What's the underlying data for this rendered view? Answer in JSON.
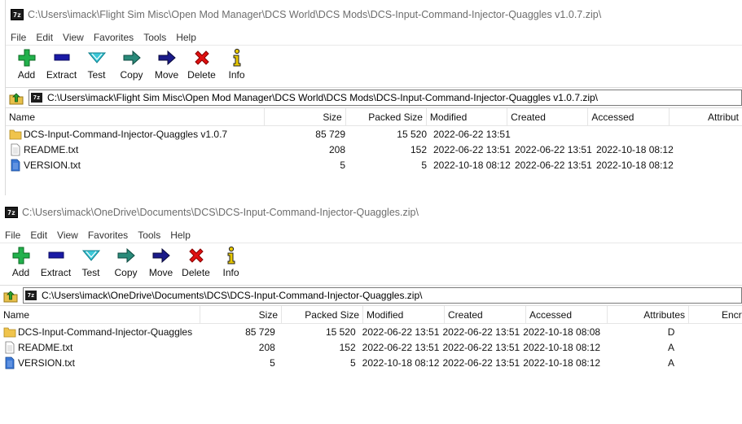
{
  "windows": [
    {
      "title": "C:\\Users\\imack\\Flight Sim Misc\\Open Mod Manager\\DCS World\\DCS Mods\\DCS-Input-Command-Injector-Quaggles v1.0.7.zip\\",
      "menu": [
        "File",
        "Edit",
        "View",
        "Favorites",
        "Tools",
        "Help"
      ],
      "toolbar": [
        "Add",
        "Extract",
        "Test",
        "Copy",
        "Move",
        "Delete",
        "Info"
      ],
      "address": "C:\\Users\\imack\\Flight Sim Misc\\Open Mod Manager\\DCS World\\DCS Mods\\DCS-Input-Command-Injector-Quaggles v1.0.7.zip\\",
      "columns": [
        "Name",
        "Size",
        "Packed Size",
        "Modified",
        "Created",
        "Accessed",
        "Attribut"
      ],
      "rows": [
        {
          "icon": "folder-icon",
          "name": "DCS-Input-Command-Injector-Quaggles v1.0.7",
          "size": "85 729",
          "packed": "15 520",
          "modified": "2022-06-22 13:51",
          "created": "",
          "accessed": ""
        },
        {
          "icon": "text-file-icon",
          "name": "README.txt",
          "size": "208",
          "packed": "152",
          "modified": "2022-06-22 13:51",
          "created": "2022-06-22 13:51",
          "accessed": "2022-10-18 08:12"
        },
        {
          "icon": "doc-file-icon",
          "name": "VERSION.txt",
          "size": "5",
          "packed": "5",
          "modified": "2022-10-18 08:12",
          "created": "2022-06-22 13:51",
          "accessed": "2022-10-18 08:12"
        }
      ]
    },
    {
      "title": "C:\\Users\\imack\\OneDrive\\Documents\\DCS\\DCS-Input-Command-Injector-Quaggles.zip\\",
      "menu": [
        "File",
        "Edit",
        "View",
        "Favorites",
        "Tools",
        "Help"
      ],
      "toolbar": [
        "Add",
        "Extract",
        "Test",
        "Copy",
        "Move",
        "Delete",
        "Info"
      ],
      "address": "C:\\Users\\imack\\OneDrive\\Documents\\DCS\\DCS-Input-Command-Injector-Quaggles.zip\\",
      "columns": [
        "Name",
        "Size",
        "Packed Size",
        "Modified",
        "Created",
        "Accessed",
        "Attributes",
        "Encry"
      ],
      "rows": [
        {
          "icon": "folder-icon",
          "name": "DCS-Input-Command-Injector-Quaggles",
          "size": "85 729",
          "packed": "15 520",
          "modified": "2022-06-22 13:51",
          "created": "2022-06-22 13:51",
          "accessed": "2022-10-18 08:08",
          "attributes": "D"
        },
        {
          "icon": "text-file-icon",
          "name": "README.txt",
          "size": "208",
          "packed": "152",
          "modified": "2022-06-22 13:51",
          "created": "2022-06-22 13:51",
          "accessed": "2022-10-18 08:12",
          "attributes": "A"
        },
        {
          "icon": "doc-file-icon",
          "name": "VERSION.txt",
          "size": "5",
          "packed": "5",
          "modified": "2022-10-18 08:12",
          "created": "2022-06-22 13:51",
          "accessed": "2022-10-18 08:12",
          "attributes": "A"
        }
      ]
    }
  ],
  "app_icon_text": "7z",
  "colors": {
    "add": "#22b14c",
    "extract": "#1a1aa6",
    "test": "#3cc8d8",
    "copy": "#2a8a7a",
    "move": "#1a1a8a",
    "delete": "#e01010",
    "info": "#e8c800"
  }
}
